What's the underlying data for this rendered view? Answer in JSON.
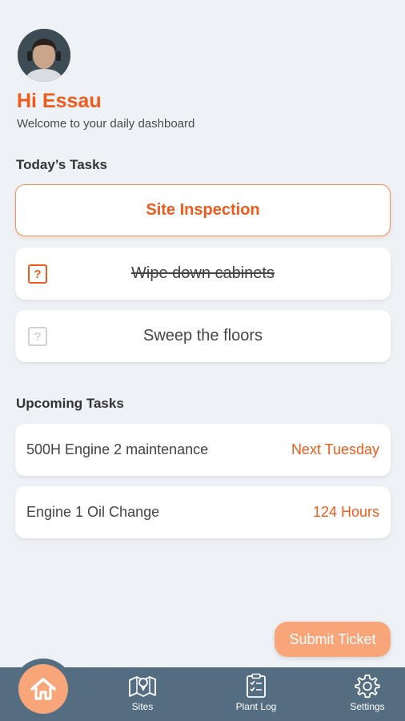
{
  "profile": {
    "greeting": "Hi Essau",
    "subtitle": "Welcome to your daily dashboard"
  },
  "todays_tasks": {
    "title": "Today’s Tasks",
    "items": [
      {
        "label": "Site Inspection",
        "state": "active"
      },
      {
        "label": "Wipe down cabinets",
        "state": "done",
        "icon": "question-icon"
      },
      {
        "label": "Sweep the floors",
        "state": "pending",
        "icon": "question-icon"
      }
    ]
  },
  "upcoming_tasks": {
    "title": "Upcoming Tasks",
    "items": [
      {
        "label": "500H Engine 2 maintenance",
        "due": "Next Tuesday"
      },
      {
        "label": "Engine 1 Oil Change",
        "due": "124 Hours"
      }
    ]
  },
  "submit_ticket_label": "Submit Ticket",
  "nav": {
    "items": [
      {
        "label": "",
        "icon": "home-icon"
      },
      {
        "label": "Sites",
        "icon": "map-icon"
      },
      {
        "label": "Plant Log",
        "icon": "clipboard-icon"
      },
      {
        "label": "Settings",
        "icon": "gear-icon"
      }
    ]
  },
  "colors": {
    "accent": "#f05a1a",
    "accent_light": "#f8a57a",
    "navbar": "#546d80",
    "background": "#eef1f5"
  },
  "question_mark": "?"
}
